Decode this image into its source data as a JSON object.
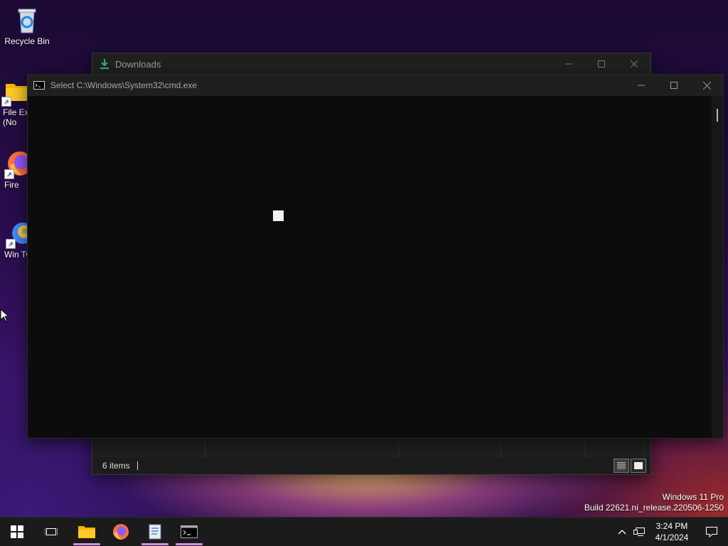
{
  "desktop": {
    "icons": [
      {
        "label": "Recycle Bin",
        "icon": "recycle-bin-icon"
      },
      {
        "label": "File Ex (No",
        "icon": "file-explorer-icon"
      },
      {
        "label": "Fire",
        "icon": "firefox-icon"
      },
      {
        "label": "Win Twe",
        "icon": "winaero-tweaker-icon"
      }
    ],
    "watermark": {
      "line1": "Windows 11 Pro",
      "line2": "Build 22621.ni_release.220506-1250"
    }
  },
  "downloads_window": {
    "title": "Downloads",
    "status_text": "6 items",
    "icon": "download-icon"
  },
  "cmd_window": {
    "title": "Select C:\\Windows\\System32\\cmd.exe",
    "icon": "cmd-icon"
  },
  "taskbar": {
    "apps": [
      "start",
      "task-view",
      "file-explorer",
      "firefox",
      "notepad",
      "cmd"
    ],
    "clock_time": "3:24 PM",
    "clock_date": "4/1/2024"
  },
  "colors": {
    "accent_indicator": "#d18de0",
    "taskbar_bg": "#1b1b1b",
    "console_bg": "#0c0c0c"
  }
}
